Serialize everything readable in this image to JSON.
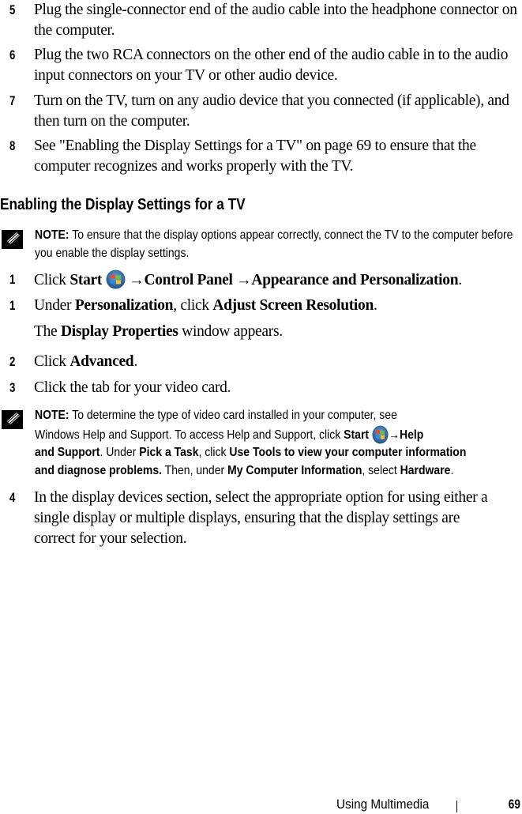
{
  "steps_top": [
    {
      "num": "5",
      "text": "Plug the single-connector end of the audio cable into the headphone connector on the computer."
    },
    {
      "num": "6",
      "text": "Plug the two RCA connectors on the other end of the audio cable in to the audio input connectors on your TV or other audio device."
    },
    {
      "num": "7",
      "text": "Turn on the TV, turn on any audio device that you connected (if applicable), and then turn on the computer."
    },
    {
      "num": "8",
      "text": "See \"Enabling the Display Settings for a TV\" on page 69 to ensure that the computer recognizes and works properly with the TV."
    }
  ],
  "section_heading": "Enabling the Display Settings for a TV",
  "note1": {
    "label": "NOTE:",
    "text": " To ensure that the display options appear correctly, connect the TV to the computer before you enable the display settings."
  },
  "steps_bottom": {
    "s1a": {
      "num": "1",
      "pre": "Click ",
      "start": "Start",
      "arrow1": " →",
      "control_panel": "Control Panel",
      "arrow2": " →",
      "appearance": "Appearance and Personalization",
      "end": "."
    },
    "s1b": {
      "num": "1",
      "pre": "Under ",
      "personalization": "Personalization",
      "mid": ", click ",
      "adjust": "Adjust Screen Resolution",
      "end": "."
    },
    "s1b_sub": {
      "pre": "The ",
      "display_props": "Display Properties",
      "post": " window appears."
    },
    "s2": {
      "num": "2",
      "pre": "Click ",
      "advanced": "Advanced",
      "end": "."
    },
    "s3": {
      "num": "3",
      "text": "Click the tab for your video card."
    },
    "s4": {
      "num": "4",
      "text": "In the display devices section, select the appropriate option for using either a single display or multiple displays, ensuring that the display settings are correct for your selection."
    }
  },
  "note2": {
    "label": "NOTE:",
    "t1": " To determine the type of video card installed in your computer, see",
    "t2": "Windows Help and Support. To access Help and Support, click ",
    "start": "Start",
    "arrow": "→",
    "help": "Help",
    "t3": "and Support",
    "t4": ". Under ",
    "pick": "Pick a Task",
    "t5": ", click ",
    "use_tools": "Use Tools to view your computer information",
    "t6": "and diagnose problems.",
    "t7": " Then, under ",
    "my_comp": "My Computer Information",
    "t8": ", select ",
    "hardware": "Hardware",
    "t9": "."
  },
  "footer": {
    "section": "Using Multimedia",
    "page_number": "69"
  }
}
